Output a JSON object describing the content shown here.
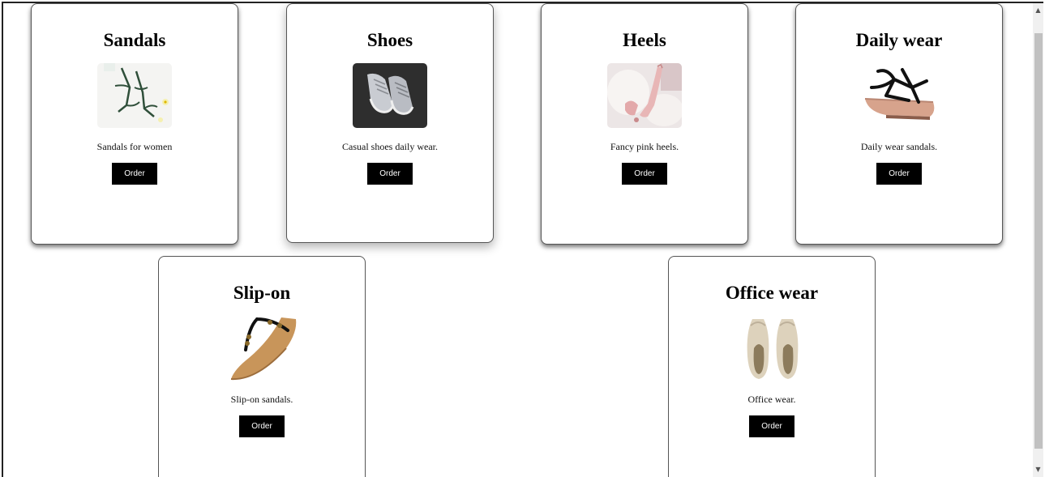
{
  "cards": [
    {
      "title": "Sandals",
      "desc": "Sandals for women",
      "button": "Order",
      "image": "green-strappy-sandals-on-white"
    },
    {
      "title": "Shoes",
      "desc": "Casual shoes daily wear.",
      "button": "Order",
      "image": "grey-sneakers-on-black"
    },
    {
      "title": "Heels",
      "desc": "Fancy pink heels.",
      "button": "Order",
      "image": "pink-heels-on-fur"
    },
    {
      "title": "Daily wear",
      "desc": "Daily wear sandals.",
      "button": "Order",
      "image": "black-strap-flat-sandal"
    },
    {
      "title": "Slip-on",
      "desc": "Slip-on sandals.",
      "button": "Order",
      "image": "tan-thong-sandal"
    },
    {
      "title": "Office wear",
      "desc": "Office wear.",
      "button": "Order",
      "image": "beige-peep-toe-flats"
    }
  ],
  "scrollbar": {
    "up_icon": "▲",
    "down_icon": "▼"
  },
  "colors": {
    "button_bg": "#000000",
    "button_text": "#ffffff",
    "card_border": "#555555"
  }
}
